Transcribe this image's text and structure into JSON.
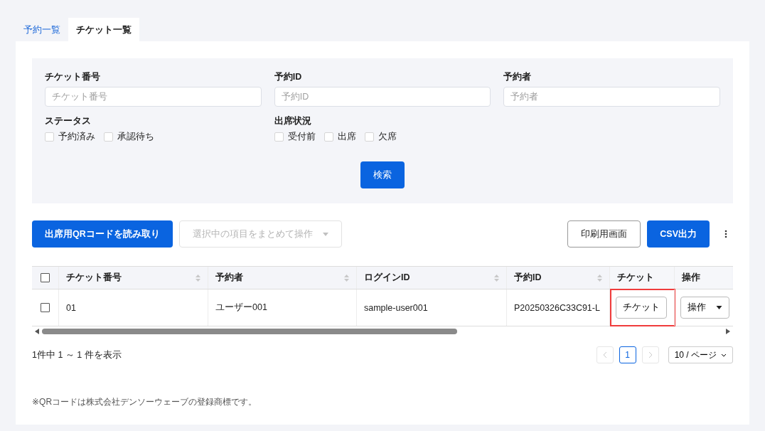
{
  "tabs": [
    {
      "label": "予約一覧",
      "selected": false
    },
    {
      "label": "チケット一覧",
      "selected": true
    }
  ],
  "filters": {
    "fields": [
      {
        "label": "チケット番号",
        "placeholder": "チケット番号"
      },
      {
        "label": "予約ID",
        "placeholder": "予約ID"
      },
      {
        "label": "予約者",
        "placeholder": "予約者"
      }
    ],
    "groups": [
      {
        "label": "ステータス",
        "options": [
          {
            "label": "予約済み",
            "checked": false
          },
          {
            "label": "承認待ち",
            "checked": false
          }
        ]
      },
      {
        "label": "出席状況",
        "options": [
          {
            "label": "受付前",
            "checked": false
          },
          {
            "label": "出席",
            "checked": false
          },
          {
            "label": "欠席",
            "checked": false
          }
        ]
      }
    ],
    "search_button": "検索"
  },
  "toolbar": {
    "scan_button": "出席用QRコードを読み取り",
    "bulk_action": {
      "label": "選択中の項目をまとめて操作",
      "disabled": true
    },
    "print_button": "印刷用画面",
    "csv_button": "CSV出力"
  },
  "table": {
    "select_all": false,
    "columns": [
      {
        "label": "チケット番号",
        "sortable": true
      },
      {
        "label": "予約者",
        "sortable": true
      },
      {
        "label": "ログインID",
        "sortable": true
      },
      {
        "label": "予約ID",
        "sortable": true
      },
      {
        "label": "チケット",
        "sortable": false
      },
      {
        "label": "操作",
        "sortable": false
      }
    ],
    "rows": [
      {
        "selected": false,
        "cells": [
          "01",
          "ユーザー001",
          "sample-user001",
          "P20250326C33C91-L"
        ],
        "ticket_button": "チケット",
        "action_button": "操作",
        "ticket_highlighted": true
      }
    ]
  },
  "summary": "1件中 1 ～ 1 件を表示",
  "pagination": {
    "pages": [
      {
        "label": "1",
        "selected": true
      }
    ],
    "page_size": "10 / ページ"
  },
  "footnote": "※QRコードは株式会社デンソーウェーブの登録商標です。"
}
